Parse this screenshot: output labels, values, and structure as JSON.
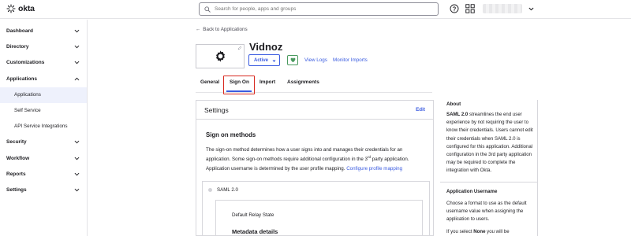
{
  "topbar": {
    "logo_text": "okta",
    "search_placeholder": "Search for people, apps and groups"
  },
  "sidebar": {
    "items": [
      {
        "label": "Dashboard",
        "expanded": false
      },
      {
        "label": "Directory",
        "expanded": false
      },
      {
        "label": "Customizations",
        "expanded": false
      },
      {
        "label": "Applications",
        "expanded": true
      },
      {
        "label": "Security",
        "expanded": false
      },
      {
        "label": "Workflow",
        "expanded": false
      },
      {
        "label": "Reports",
        "expanded": false
      },
      {
        "label": "Settings",
        "expanded": false
      }
    ],
    "applications_sub": [
      {
        "label": "Applications",
        "active": true
      },
      {
        "label": "Self Service",
        "active": false
      },
      {
        "label": "API Service Integrations",
        "active": false
      }
    ]
  },
  "app_header": {
    "back_link": "Back to Applications",
    "app_name": "Vidnoz",
    "status": "Active",
    "view_logs": "View Logs",
    "monitor_imports": "Monitor Imports"
  },
  "tabs": [
    {
      "label": "General"
    },
    {
      "label": "Sign On",
      "active": true
    },
    {
      "label": "Import"
    },
    {
      "label": "Assignments"
    }
  ],
  "settings": {
    "title": "Settings",
    "edit": "Edit",
    "signon_methods_title": "Sign on methods",
    "desc_part1": "The sign-on method determines how a user signs into and manages their credentials for an application. Some sign-on methods require additional configuration in the 3",
    "desc_sup": "rd",
    "desc_part2": " party application.",
    "mapping_text": "Application username is determined by the user profile mapping.",
    "mapping_link": "Configure profile mapping",
    "saml_label": "SAML 2.0",
    "relay_state": "Default Relay State",
    "metadata_title": "Metadata details"
  },
  "about": {
    "title": "About",
    "saml_bold": "SAML 2.0",
    "saml_text": " streamlines the end user experience by not requiring the user to know their credentials. Users cannot edit their credentials when SAML 2.0 is configured for this application. Additional configuration in the 3rd party application may be required to complete the integration with Okta.",
    "username_title": "Application Username",
    "username_text": "Choose a format to use as the default username value when assigning the application to users.",
    "select_prefix": "If you select ",
    "select_bold": "None",
    "select_suffix": " you will be"
  },
  "colors": {
    "accent": "#3a5be0",
    "highlight": "#d8281f",
    "active_nav_bg": "#eef1fc",
    "heart": "#4a9a5f"
  }
}
